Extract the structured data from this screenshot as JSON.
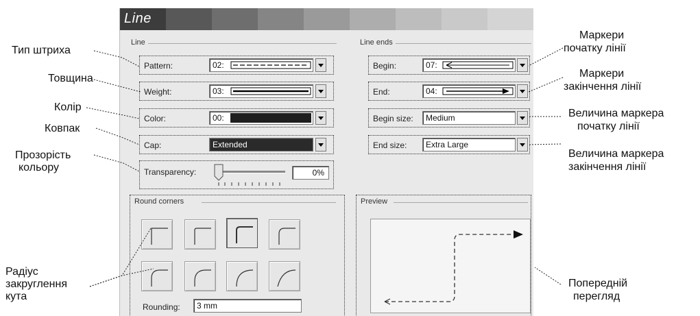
{
  "dialog": {
    "title": "Line",
    "line_group": "Line",
    "line_ends_group": "Line ends",
    "round_corners_group": "Round corners",
    "preview_group": "Preview",
    "pattern": {
      "label": "Pattern:",
      "value": "02:"
    },
    "weight": {
      "label": "Weight:",
      "value": "03:"
    },
    "color": {
      "label": "Color:",
      "value": "00:"
    },
    "cap": {
      "label": "Cap:",
      "value": "Extended"
    },
    "transparency": {
      "label": "Transparency:",
      "value": "0%",
      "fraction": 0.0
    },
    "begin": {
      "label": "Begin:",
      "value": "07:"
    },
    "end": {
      "label": "End:",
      "value": "04:"
    },
    "begin_size": {
      "label": "Begin size:",
      "value": "Medium"
    },
    "end_size": {
      "label": "End size:",
      "value": "Extra Large"
    },
    "rounding": {
      "label": "Rounding:",
      "value": "3 mm"
    }
  },
  "annotations": {
    "stroke_type": "Тип штриха",
    "thickness": "Товщина",
    "color": "Колір",
    "cap": "Ковпак",
    "transparency_1": "Прозорість",
    "transparency_2": "кольору",
    "radius_1": "Радіус",
    "radius_2": "закруглення",
    "radius_3": "кута",
    "begin_markers_1": "Маркери",
    "begin_markers_2": "початку лінії",
    "end_markers_1": "Маркери",
    "end_markers_2": "закінчення лінії",
    "begin_size_1": "Величина маркера",
    "begin_size_2": "початку лінії",
    "end_size_1": "Величина маркера",
    "end_size_2": "закінчення лінії",
    "preview_1": "Попередній",
    "preview_2": "перегляд"
  },
  "colors": {
    "title_from": "#3c3c3c",
    "title_to": "#d4d4d4",
    "dialog_bg": "#e9e9e9"
  }
}
